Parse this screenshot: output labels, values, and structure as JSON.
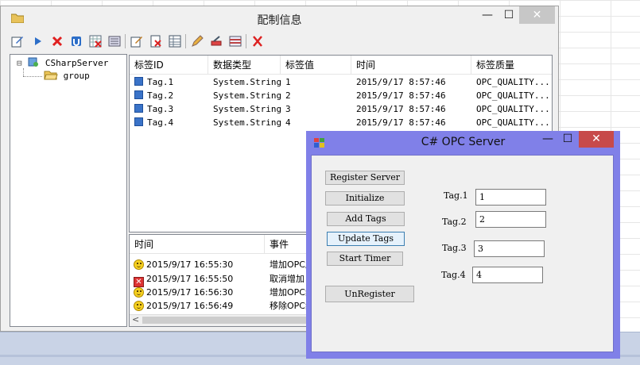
{
  "main_window": {
    "title": "配制信息",
    "controls": {
      "minimize": "—",
      "maximize": "☐",
      "close": "✕"
    }
  },
  "tree": {
    "root_label": "CSharpServer",
    "child_label": "group",
    "root_toggle": "⊟"
  },
  "tag_table": {
    "columns": [
      "标签ID",
      "数据类型",
      "标签值",
      "时间",
      "标签质量"
    ],
    "rows": [
      {
        "id": "Tag.1",
        "type": "System.String",
        "value": "1",
        "time": "2015/9/17 8:57:46",
        "quality": "OPC_QUALITY..."
      },
      {
        "id": "Tag.2",
        "type": "System.String",
        "value": "2",
        "time": "2015/9/17 8:57:46",
        "quality": "OPC_QUALITY..."
      },
      {
        "id": "Tag.3",
        "type": "System.String",
        "value": "3",
        "time": "2015/9/17 8:57:46",
        "quality": "OPC_QUALITY..."
      },
      {
        "id": "Tag.4",
        "type": "System.String",
        "value": "4",
        "time": "2015/9/17 8:57:46",
        "quality": "OPC_QUALITY..."
      }
    ]
  },
  "event_log": {
    "columns": [
      "时间",
      "事件"
    ],
    "rows": [
      {
        "icon": "smile-icon",
        "time": "2015/9/17 16:55:30",
        "event": "增加OPC服"
      },
      {
        "icon": "error-icon",
        "time": "2015/9/17 16:55:50",
        "event": "取消增加"
      },
      {
        "icon": "smile-icon",
        "time": "2015/9/17 16:56:30",
        "event": "增加OPC组"
      },
      {
        "icon": "smile-icon",
        "time": "2015/9/17 16:56:49",
        "event": "移除OPC组"
      }
    ],
    "scroll_left": "<"
  },
  "opc_window": {
    "title": "C# OPC Server",
    "controls": {
      "minimize": "—",
      "maximize": "☐",
      "close": "✕"
    },
    "buttons": {
      "register": "Register Server",
      "initialize": "Initialize",
      "add_tags": "Add Tags",
      "update_tags": "Update Tags",
      "start_timer": "Start Timer",
      "unregister": "UnRegister"
    },
    "tags": [
      {
        "label": "Tag.1",
        "value": "1"
      },
      {
        "label": "Tag.2",
        "value": "2"
      },
      {
        "label": "Tag.3",
        "value": "3"
      },
      {
        "label": "Tag.4",
        "value": "4"
      }
    ]
  },
  "colors": {
    "opc_frame": "#8080e8",
    "close_red": "#c74a4a",
    "row_icon": "#3a73c8"
  }
}
